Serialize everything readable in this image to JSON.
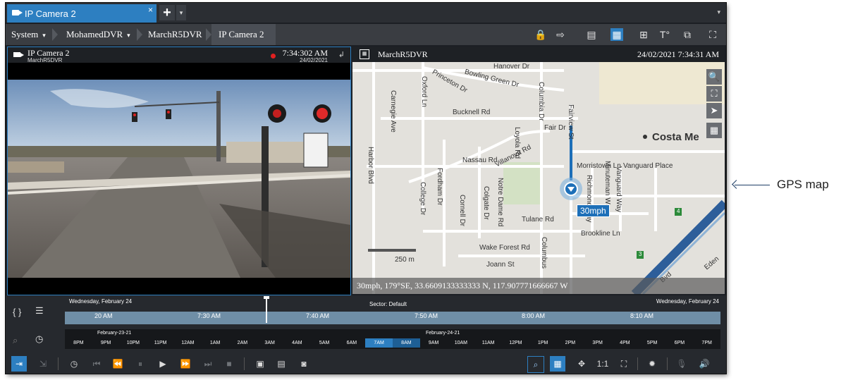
{
  "tab": {
    "title": "IP Camera 2",
    "close": "×",
    "add": "+",
    "dropdown": "▾",
    "window_menu": "▾"
  },
  "breadcrumb": [
    {
      "label": "System",
      "dd": "▾"
    },
    {
      "label": "MohamedDVR",
      "dd": "▾"
    },
    {
      "label": "MarchR5DVR",
      "dd": ""
    },
    {
      "label": "IP Camera 2",
      "dd": ""
    }
  ],
  "toolbar_icons": [
    "lock-icon",
    "export-icon",
    "bookmark-icon",
    "map-view-icon",
    "layout-icon",
    "text-overlay-icon",
    "add-tile-icon",
    "fullscreen-icon"
  ],
  "left_pane": {
    "title": "IP Camera 2",
    "subtitle": "MarchR5DVR",
    "time": "7:34:302 AM",
    "date": "24/02/2021"
  },
  "right_pane": {
    "title": "MarchR5DVR",
    "datetime": "24/02/2021 7:34:31 AM"
  },
  "map": {
    "streets": {
      "hanover": "Hanover Dr",
      "bowling": "Bowling Green Dr",
      "princeton": "Princeton Dr",
      "bucknell": "Bucknell Rd",
      "nassau": "Nassau Rd",
      "villanova": "Villanova Rd",
      "fair": "Fair Dr",
      "morristown": "Morristown Ln",
      "vanguard": "Vanguard Place",
      "tulane": "Tulane Rd",
      "brookline": "Brookline Ln",
      "wakeforest": "Wake Forest Rd",
      "joann": "Joann St",
      "harbor": "Harbor Blvd",
      "carnegie": "Carnegie Ave",
      "oxford": "Oxford Ln",
      "columbia": "Columbia Dr",
      "loyola": "Loyola Rd",
      "fordham": "Fordham Dr",
      "college": "College Dr",
      "cornell": "Cornell Dr",
      "colgate": "Colgate Dr",
      "notredame": "Notre Dame Rd",
      "fairview": "Fairview St",
      "richmond": "Richmond Way",
      "minuteman": "Minuteman Way",
      "vanguardway": "Vanguard Way",
      "columbus": "Columbus",
      "cloverbvd": "Bvd",
      "eden": "Eden"
    },
    "city": "Costa Me",
    "speed": "30mph",
    "scale": "250 m",
    "readout": "30mph, 179°SE, 33.6609133333333 N, 117.907771666667 W",
    "tools": [
      "🔍",
      "⛶",
      "➤",
      "▦"
    ],
    "shields": [
      "4",
      "3"
    ]
  },
  "timeline": {
    "left_date": "Wednesday, February 24",
    "sector": "Sector: Default",
    "right_date": "Wednesday, February 24",
    "marks": [
      "20 AM",
      "7:30 AM",
      "7:40 AM",
      "7:50 AM",
      "8:00 AM",
      "8:10 AM"
    ],
    "day1": "February-23-21",
    "day2": "February-24-21",
    "hours": [
      "8PM",
      "9PM",
      "10PM",
      "11PM",
      "12AM",
      "1AM",
      "2AM",
      "3AM",
      "4AM",
      "5AM",
      "6AM",
      "7AM",
      "8AM",
      "9AM",
      "10AM",
      "11AM",
      "12PM",
      "1PM",
      "2PM",
      "3PM",
      "4PM",
      "5PM",
      "6PM",
      "7PM"
    ]
  },
  "controls": {
    "ratio": "1:1"
  },
  "callout": "GPS map",
  "colors": {
    "accent": "#2d7fc1",
    "frame": "#1c1f24"
  }
}
